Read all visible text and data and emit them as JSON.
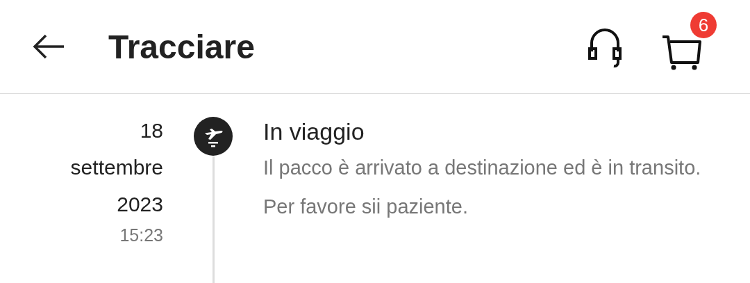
{
  "header": {
    "title": "Tracciare",
    "cart_badge": "6"
  },
  "events": [
    {
      "date": "18 settembre 2023",
      "time": "15:23",
      "title": "In viaggio",
      "description": "Il pacco è arrivato a destinazione ed è in transito. Per favore sii paziente.",
      "kind": "flight"
    }
  ]
}
